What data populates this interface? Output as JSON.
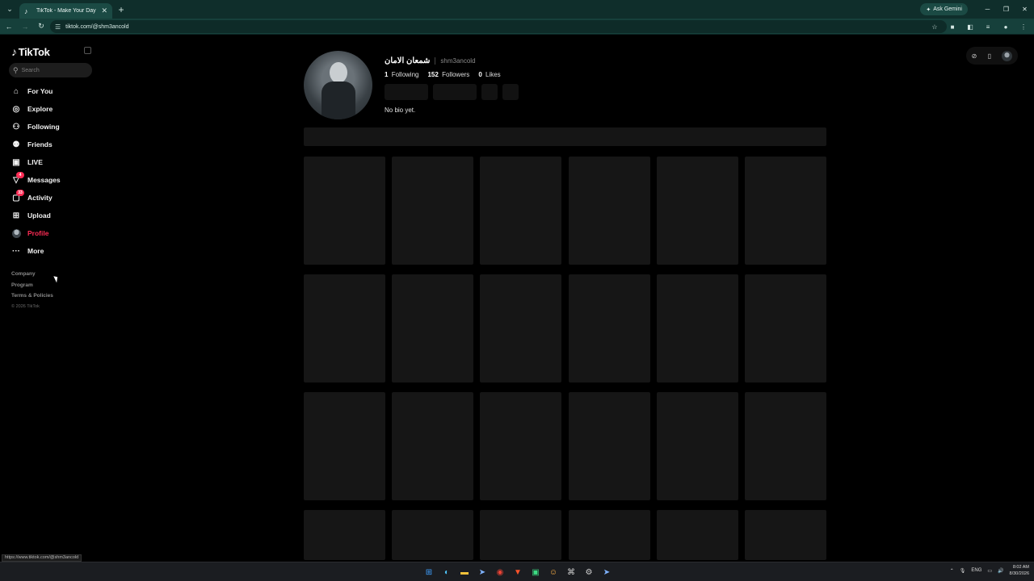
{
  "browser": {
    "tab_title": "TikTok - Make Your Day",
    "tab_list_icon": "chevron-down-icon",
    "url": "tiktok.com/@shm3ancold",
    "ask_gemini": "Ask Gemini",
    "status_url": "https://www.tiktok.com/@shm3ancold",
    "theme_color": "#16403b"
  },
  "sidebar": {
    "brand": "TikTok",
    "search_placeholder": "Search",
    "nav": [
      {
        "label": "For You",
        "icon": "home-icon"
      },
      {
        "label": "Explore",
        "icon": "compass-icon"
      },
      {
        "label": "Following",
        "icon": "user-follow-icon"
      },
      {
        "label": "Friends",
        "icon": "friends-icon"
      },
      {
        "label": "LIVE",
        "icon": "live-icon"
      },
      {
        "label": "Messages",
        "icon": "send-icon",
        "badge": "4"
      },
      {
        "label": "Activity",
        "icon": "inbox-icon",
        "badge": "33"
      },
      {
        "label": "Upload",
        "icon": "plus-square-icon"
      },
      {
        "label": "Profile",
        "icon": "avatar-icon",
        "active": true
      },
      {
        "label": "More",
        "icon": "more-icon"
      }
    ],
    "footer": [
      "Company",
      "Program",
      "Terms & Policies"
    ],
    "copyright": "© 2026 TikTok",
    "accent_color": "#fe2c55"
  },
  "profile": {
    "display_name": "شمعان الامان",
    "username": "shm3ancold",
    "following_count": "1",
    "following_label": "Following",
    "followers_count": "152",
    "followers_label": "Followers",
    "likes_count": "0",
    "likes_label": "Likes",
    "bio": "No bio yet."
  },
  "taskbar": {
    "lang": "ENG",
    "time": "8:02 AM",
    "date": "8/30/2026"
  }
}
